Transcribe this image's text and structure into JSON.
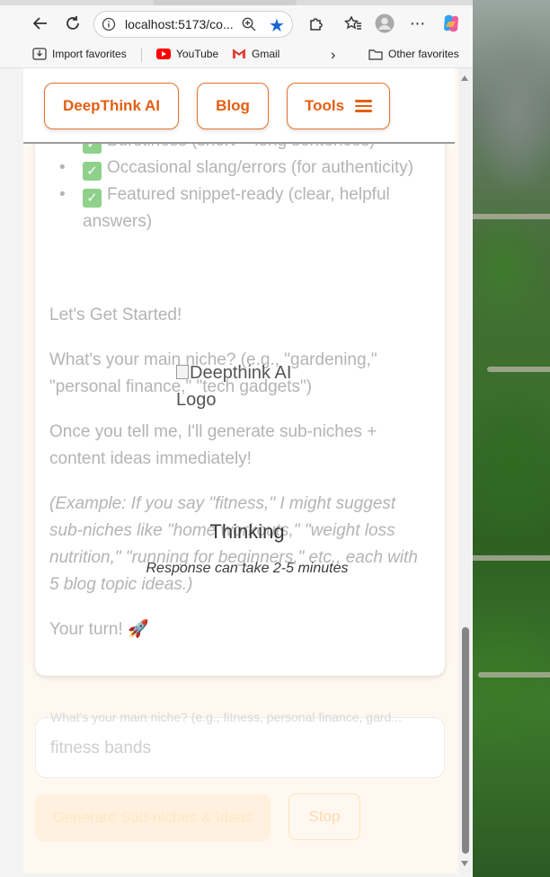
{
  "browser": {
    "url": "localhost:5173/co...",
    "favorites": {
      "import": "Import favorites",
      "youtube": "YouTube",
      "gmail": "Gmail",
      "other": "Other favorites"
    }
  },
  "nav": {
    "brand": "DeepThink AI",
    "blog": "Blog",
    "tools": "Tools"
  },
  "content": {
    "bullets": [
      "Burstiness (short + long sentences)",
      "Occasional slang/errors (for authenticity)",
      "Featured snippet-ready (clear, helpful answers)"
    ],
    "lets_start": "Let's Get Started!",
    "question": "What's your main niche? (e.g., \"gardening,\" \"personal finance,\" \"tech gadgets\")",
    "once": "Once you tell me, I'll generate sub-niches + content ideas immediately!",
    "example": "(Example: If you say \"fitness,\" I might suggest sub-niches like \"home workouts,\" \"weight loss nutrition,\" \"running for beginners,\" etc., each with 5 blog topic ideas.)",
    "your_turn": "Your turn! 🚀"
  },
  "overlay": {
    "logo_alt": "Deepthink AI Logo",
    "thinking": "Thinking",
    "note": "Response can take 2-5 minutes"
  },
  "form": {
    "placeholder": "What's your main niche? (e.g., fitness, personal finance, gard...",
    "value": "fitness bands",
    "generate": "Generate Sub-niches & Ideas",
    "stop": "Stop"
  },
  "colors": {
    "accent": "#e35f12",
    "page_bg": "#fff8f0"
  }
}
